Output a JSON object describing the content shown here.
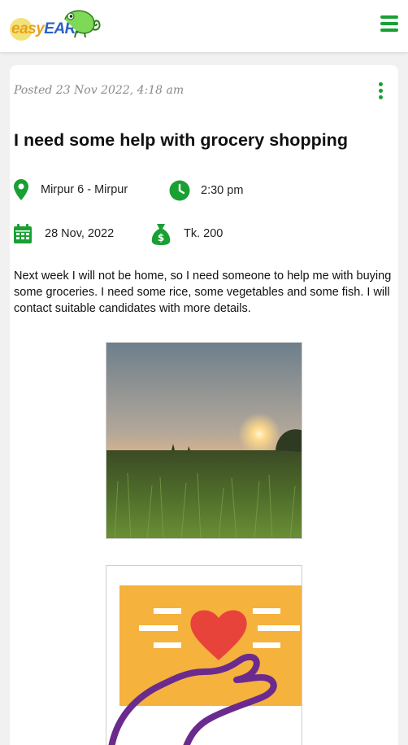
{
  "header": {
    "logo_part1": "easy",
    "logo_part2": "EARN",
    "menu_icon": "hamburger-menu-icon"
  },
  "post": {
    "posted": "Posted 23 Nov 2022, 4:18 am",
    "title": "I need some help with grocery shopping",
    "location": "Mirpur 6 - Mirpur",
    "time": "2:30 pm",
    "date": "28 Nov, 2022",
    "price": "Tk. 200",
    "description": "Next week I will not be home, so I need someone to help me with buying some groceries. I need some rice, some vegetables and some fish. I will contact suitable candidates with more details."
  },
  "colors": {
    "accent": "#19a033",
    "logo_yellow": "#e8a21a",
    "logo_blue": "#2b62c8",
    "card_bg": "#ffffff",
    "page_bg": "#f1f1f1"
  }
}
